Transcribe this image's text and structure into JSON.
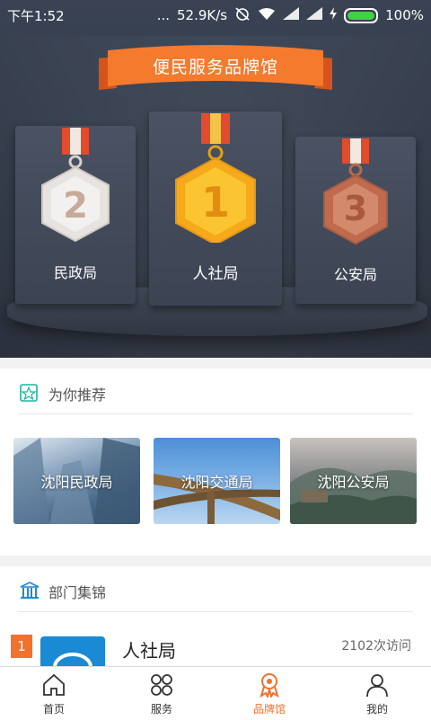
{
  "status_bar": {
    "time": "下午1:52",
    "dots": "...",
    "speed": "52.9K/s",
    "battery_pct": "100%"
  },
  "banner": {
    "title": "便民服务品牌馆"
  },
  "podium": [
    {
      "rank": "2",
      "name": "民政局"
    },
    {
      "rank": "1",
      "name": "人社局"
    },
    {
      "rank": "3",
      "name": "公安局"
    }
  ],
  "recommend": {
    "title": "为你推荐",
    "items": [
      "沈阳民政局",
      "沈阳交通局",
      "沈阳公安局"
    ]
  },
  "departments": {
    "title": "部门集锦",
    "rows": [
      {
        "rank": "1",
        "name": "人社局",
        "visits": "2102次访问"
      }
    ]
  },
  "tabs": [
    {
      "label": "首页",
      "icon": "home-icon"
    },
    {
      "label": "服务",
      "icon": "grid-icon"
    },
    {
      "label": "品牌馆",
      "icon": "medal-icon"
    },
    {
      "label": "我的",
      "icon": "user-icon"
    }
  ],
  "colors": {
    "accent": "#f0722c",
    "hero_bg": "#333a48",
    "gold": "#f7b21b",
    "silver": "#e6e3e0",
    "bronze": "#c8775a"
  }
}
